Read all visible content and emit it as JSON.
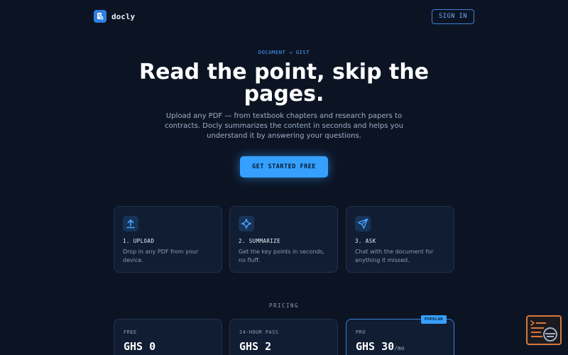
{
  "header": {
    "brand": "docly",
    "signin_label": "SIGN IN"
  },
  "hero": {
    "eyebrow": "DOCUMENT → GIST",
    "headline": "Read the point, skip the pages.",
    "subtitle": "Upload any PDF — from textbook chapters and research papers to contracts. Docly summarizes the content in seconds and helps you understand it by answering your questions.",
    "cta_label": "GET STARTED FREE"
  },
  "steps": [
    {
      "icon": "upload-icon",
      "title": "1. UPLOAD",
      "desc": "Drop in any PDF from your device."
    },
    {
      "icon": "sparkle-icon",
      "title": "2. SUMMARIZE",
      "desc": "Get the key points in seconds, no fluff."
    },
    {
      "icon": "send-icon",
      "title": "3. ASK",
      "desc": "Chat with the document for anything it missed."
    }
  ],
  "pricing": {
    "label": "PRICING",
    "plans": [
      {
        "name": "FREE",
        "price": "GHS 0",
        "suffix": ""
      },
      {
        "name": "24-HOUR PASS",
        "price": "GHS 2",
        "suffix": ""
      },
      {
        "name": "PRO",
        "price": "GHS 30",
        "suffix": "/mo",
        "badge": "POPULAR"
      }
    ]
  },
  "colors": {
    "background": "#0c1424",
    "accent": "#35a0ff",
    "card": "#111d33"
  }
}
